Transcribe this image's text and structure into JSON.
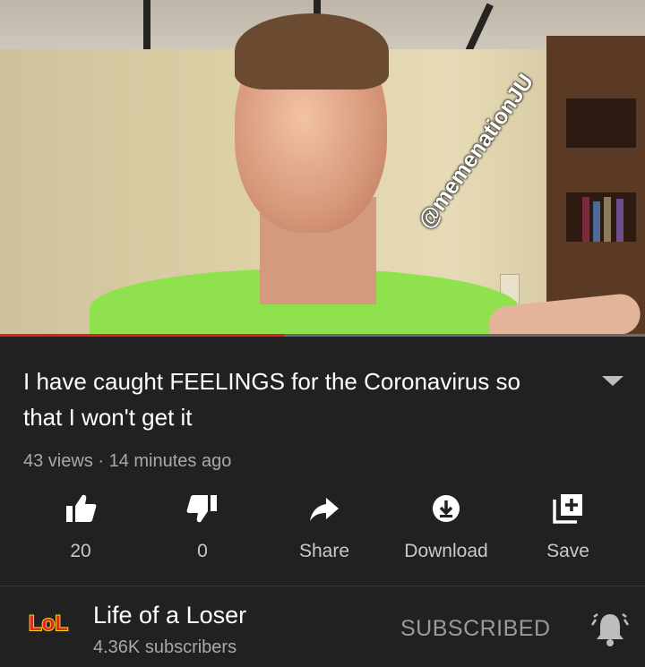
{
  "video": {
    "watermark": "@memenationJU",
    "progress_fraction": 0.44
  },
  "details": {
    "title": "I have caught FEELINGS for the Coronavirus so that I won't get it",
    "meta": "43 views · 14 minutes ago"
  },
  "actions": {
    "like_count": "20",
    "dislike_count": "0",
    "share_label": "Share",
    "download_label": "Download",
    "save_label": "Save"
  },
  "channel": {
    "avatar_text": "LoL",
    "name": "Life of a Loser",
    "subscribers": "4.36K subscribers",
    "subscribe_state": "SUBSCRIBED"
  },
  "colors": {
    "background": "#212121",
    "progress": "#e41e1e",
    "muted_text": "#a9a9a9",
    "avatar": "#e02a1e"
  },
  "icons": [
    "thumbs-up-icon",
    "thumbs-down-icon",
    "share-arrow-icon",
    "download-icon",
    "save-playlist-icon",
    "bell-icon",
    "chevron-down-icon"
  ]
}
